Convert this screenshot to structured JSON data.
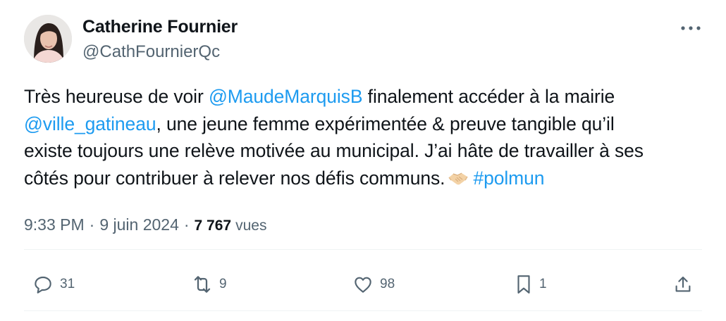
{
  "author": {
    "name": "Catherine Fournier",
    "handle": "@CathFournierQc"
  },
  "tweet": {
    "line1_text": "Très heureuse de voir ",
    "line1_mention": "@MaudeMarquisB",
    "line1_rest": " finalement accéder à la mairie",
    "line2_mention": "@ville_gatineau",
    "line2_rest": ", une jeune femme expérimentée & preuve tangible qu’il",
    "line3": "existe toujours une relève motivée au municipal. J’ai hâte de travailler à ses",
    "line4_text": "côtés pour contribuer à relever nos défis communs.",
    "hashtag": "#polmun",
    "emoji_icon": "handshake-icon"
  },
  "meta": {
    "time": "9:33 PM",
    "separator": "·",
    "date": "9 juin 2024",
    "views_count": "7 767",
    "views_label": "vues"
  },
  "actions": {
    "reply_count": "31",
    "repost_count": "9",
    "like_count": "98",
    "bookmark_count": "1"
  },
  "colors": {
    "link": "#1d9bf0",
    "text": "#0f1419",
    "secondary": "#536471",
    "divider": "#eff3f4"
  }
}
